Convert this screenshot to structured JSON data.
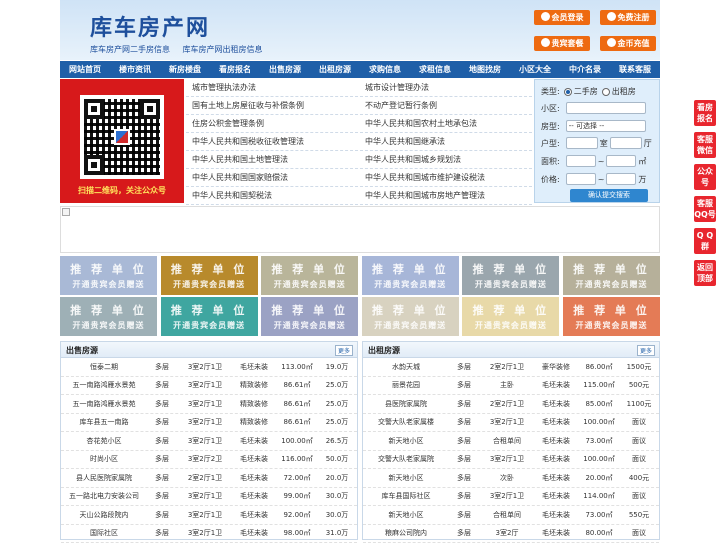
{
  "header": {
    "logo": "库车房产网",
    "sub_links": [
      "库车房产网二手房信息",
      "库车房产网出租房信息"
    ],
    "buttons": [
      {
        "label": "会员登录",
        "icon": "user-icon"
      },
      {
        "label": "免费注册",
        "icon": "person-add-icon"
      },
      {
        "label": "贵宾套餐",
        "icon": "vip-icon"
      },
      {
        "label": "金币充值",
        "icon": "coin-icon"
      }
    ]
  },
  "nav": [
    "网站首页",
    "楼市资讯",
    "新房楼盘",
    "看房报名",
    "出售房源",
    "出租房源",
    "求购信息",
    "求租信息",
    "地图找房",
    "小区大全",
    "中介名录",
    "联系客服"
  ],
  "qr": {
    "caption": "扫描二维码，关注公众号"
  },
  "links": [
    [
      "城市管理执法办法",
      "城市设计管理办法"
    ],
    [
      "国有土地上房屋征收与补偿条例",
      "不动产登记暂行条例"
    ],
    [
      "住房公积金管理条例",
      "中华人民共和国农村土地承包法"
    ],
    [
      "中华人民共和国税收征收管理法",
      "中华人民共和国继承法"
    ],
    [
      "中华人民共和国土地管理法",
      "中华人民共和国城乡规划法"
    ],
    [
      "中华人民共和国国家赔偿法",
      "中华人民共和国城市维护建设税法"
    ],
    [
      "中华人民共和国契税法",
      "中华人民共和国城市房地产管理法"
    ]
  ],
  "search": {
    "type_label": "类型:",
    "type_options": [
      "二手房",
      "出租房"
    ],
    "community_label": "小区:",
    "house_type_label": "房型:",
    "house_type_value": "-- 可选择 --",
    "layout_label": "户型:",
    "room_unit": "室",
    "hall_unit": "厅",
    "area_label": "面积:",
    "area_unit": "㎡",
    "price_label": "价格:",
    "price_unit": "万",
    "range_sep": "~",
    "submit": "确认提交搜索"
  },
  "ads": {
    "title": "推 荐 单 位",
    "subtitle": "开通贵宾会员赠送",
    "colors": [
      "#a9b9d6",
      "#b88a2c",
      "#b9b59a",
      "#a7b6d8",
      "#9aa6ad",
      "#b6b09a",
      "#9eb0b6",
      "#3fa6a0",
      "#9ba2c4",
      "#d8d2c0",
      "#e8d9a8",
      "#e47b56"
    ]
  },
  "sale": {
    "title": "出售房源",
    "more": "更多",
    "rows": [
      [
        "恒泰二期",
        "多层",
        "3室2厅1卫",
        "毛坯未装",
        "113.00㎡",
        "19.0万"
      ],
      [
        "五一南路鸿雁水景苑",
        "多层",
        "3室2厅1卫",
        "精致装修",
        "86.61㎡",
        "25.0万"
      ],
      [
        "五一南路鸿雁水景苑",
        "多层",
        "3室2厅1卫",
        "精致装修",
        "86.61㎡",
        "25.0万"
      ],
      [
        "库车县五一南路",
        "多层",
        "3室2厅1卫",
        "精致装修",
        "86.61㎡",
        "25.0万"
      ],
      [
        "杏花苑小区",
        "多层",
        "3室2厅1卫",
        "毛坯未装",
        "100.00㎡",
        "26.5万"
      ],
      [
        "时尚小区",
        "多层",
        "3室2厅2卫",
        "毛坯未装",
        "116.00㎡",
        "50.0万"
      ],
      [
        "县人民医院家属院",
        "多层",
        "2室2厅1卫",
        "毛坯未装",
        "72.00㎡",
        "20.0万"
      ],
      [
        "五一路北电力安装公司",
        "多层",
        "3室2厅1卫",
        "毛坯未装",
        "99.00㎡",
        "30.0万"
      ],
      [
        "天山公路段院内",
        "多层",
        "3室2厅1卫",
        "毛坯未装",
        "92.00㎡",
        "30.0万"
      ],
      [
        "国际社区",
        "多层",
        "3室2厅1卫",
        "毛坯未装",
        "98.00㎡",
        "31.0万"
      ]
    ]
  },
  "rent": {
    "title": "出租房源",
    "more": "更多",
    "rows": [
      [
        "水韵天城",
        "多层",
        "2室2厅1卫",
        "豪华装修",
        "86.00㎡",
        "1500元"
      ],
      [
        "丽景花园",
        "多层",
        "主卧",
        "毛坯未装",
        "115.00㎡",
        "500元"
      ],
      [
        "县医院家属院",
        "多层",
        "2室2厅1卫",
        "毛坯未装",
        "85.00㎡",
        "1100元"
      ],
      [
        "交警大队老家属楼",
        "多层",
        "3室2厅1卫",
        "毛坯未装",
        "100.00㎡",
        "面议"
      ],
      [
        "新天地小区",
        "多层",
        "合租单间",
        "毛坯未装",
        "73.00㎡",
        "面议"
      ],
      [
        "交警大队老家属院",
        "多层",
        "3室2厅1卫",
        "毛坯未装",
        "100.00㎡",
        "面议"
      ],
      [
        "新天地小区",
        "多层",
        "次卧",
        "毛坯未装",
        "20.00㎡",
        "400元"
      ],
      [
        "库车县国际社区",
        "多层",
        "3室2厅1卫",
        "毛坯未装",
        "114.00㎡",
        "面议"
      ],
      [
        "新天地小区",
        "多层",
        "合租单间",
        "毛坯未装",
        "73.00㎡",
        "550元"
      ],
      [
        "粮麻公司院内",
        "多层",
        "3室2厅",
        "毛坯未装",
        "80.00㎡",
        "面议"
      ]
    ]
  },
  "sidebar": [
    [
      "看房",
      "报名"
    ],
    [
      "客服",
      "微信"
    ],
    [
      "公众",
      "号"
    ],
    [
      "客服",
      "QQ号"
    ],
    [
      "Q Q",
      "群"
    ],
    [
      "返回",
      "顶部"
    ]
  ]
}
